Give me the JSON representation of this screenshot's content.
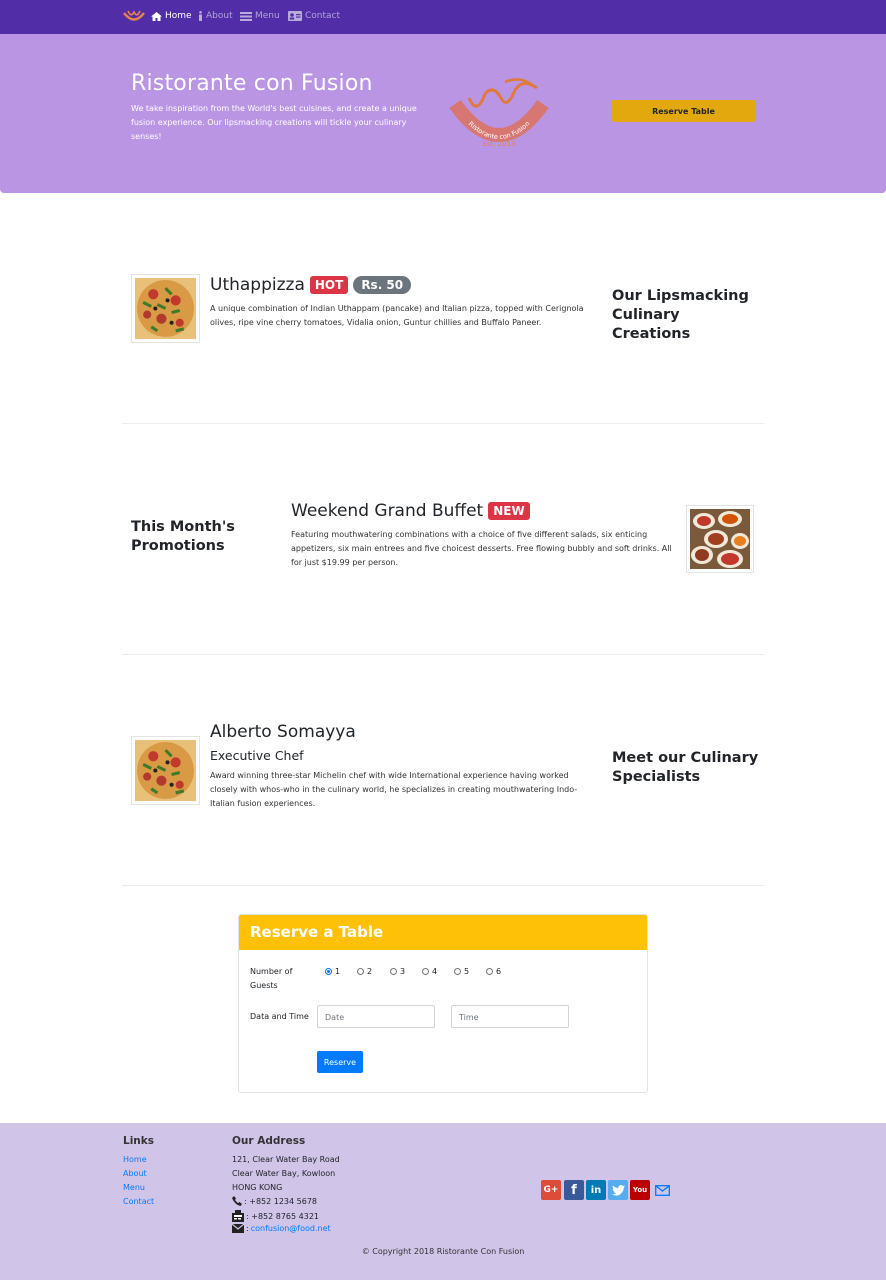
{
  "navbar": {
    "items": [
      {
        "label": "Home",
        "icon": "home-icon",
        "active": true
      },
      {
        "label": "About",
        "icon": "info-icon",
        "active": false
      },
      {
        "label": "Menu",
        "icon": "list-icon",
        "active": false
      },
      {
        "label": "Contact",
        "icon": "address-card-icon",
        "active": false
      }
    ]
  },
  "jumbotron": {
    "title": "Ristorante con Fusion",
    "text": "We take inspiration from the World's best cuisines, and create a unique fusion experience. Our lipsmacking creations will tickle your culinary senses!",
    "logo_text": "Ristorante con Fusion",
    "logo_est": "Est. 2013",
    "reserve_label": "Reserve Table"
  },
  "dish": {
    "name": "Uthappizza",
    "badge": "HOT",
    "price": "Rs. 50",
    "description": "A unique combination of Indian Uthappam (pancake) and Italian pizza, topped with Cerignola olives, ripe vine cherry tomatoes, Vidalia onion, Guntur chillies and Buffalo Paneer.",
    "side_heading": "Our Lipsmacking Culinary Creations"
  },
  "promotion": {
    "name": "Weekend Grand Buffet",
    "badge": "NEW",
    "description": "Featuring mouthwatering combinations with a choice of five different salads, six enticing appetizers, six main entrees and five choicest desserts. Free flowing bubbly and soft drinks. All for just $19.99 per person.",
    "side_heading": "This Month's Promotions"
  },
  "leader": {
    "name": "Alberto Somayya",
    "designation": "Executive Chef",
    "description": "Award winning three-star Michelin chef with wide International experience having worked closely with whos-who in the culinary world, he specializes in creating mouthwatering Indo-Italian fusion experiences.",
    "side_heading": "Meet our Culinary Specialists"
  },
  "reserve": {
    "title": "Reserve a Table",
    "guests_label": "Number of Guests",
    "guest_options": [
      "1",
      "2",
      "3",
      "4",
      "5",
      "6"
    ],
    "selected_guests": "1",
    "datetime_label": "Data and Time",
    "date_placeholder": "Date",
    "time_placeholder": "Time",
    "submit_label": "Reserve"
  },
  "footer": {
    "links_heading": "Links",
    "links": [
      "Home",
      "About",
      "Menu",
      "Contact"
    ],
    "address_heading": "Our Address",
    "address_lines": [
      "121, Clear Water Bay Road",
      "Clear Water Bay, Kowloon",
      "HONG KONG"
    ],
    "phone": ": +852 1234 5678",
    "fax": ": +852 8765 4321",
    "email_prefix": ":",
    "email": "confusion@food.net",
    "social": [
      {
        "icon": "google-plus-icon",
        "text": "G+",
        "color": "#dd4b39"
      },
      {
        "icon": "facebook-icon",
        "text": "f",
        "color": "#3b5998"
      },
      {
        "icon": "linkedin-icon",
        "text": "in",
        "color": "#007bb5"
      },
      {
        "icon": "twitter-icon",
        "text": "t",
        "color": "#55acee"
      },
      {
        "icon": "youtube-icon",
        "text": "You",
        "color": "#bb0000"
      },
      {
        "icon": "mail-icon",
        "text": "",
        "color": "#007bff"
      }
    ],
    "copyright": "© Copyright 2018 Ristorante Con Fusion"
  },
  "colors": {
    "navbar": "#512DA8",
    "jumbotron": "#B995E4",
    "reserve_button": "#E3A80D",
    "card_header": "#FFC107",
    "footer": "#D1C4E9"
  }
}
